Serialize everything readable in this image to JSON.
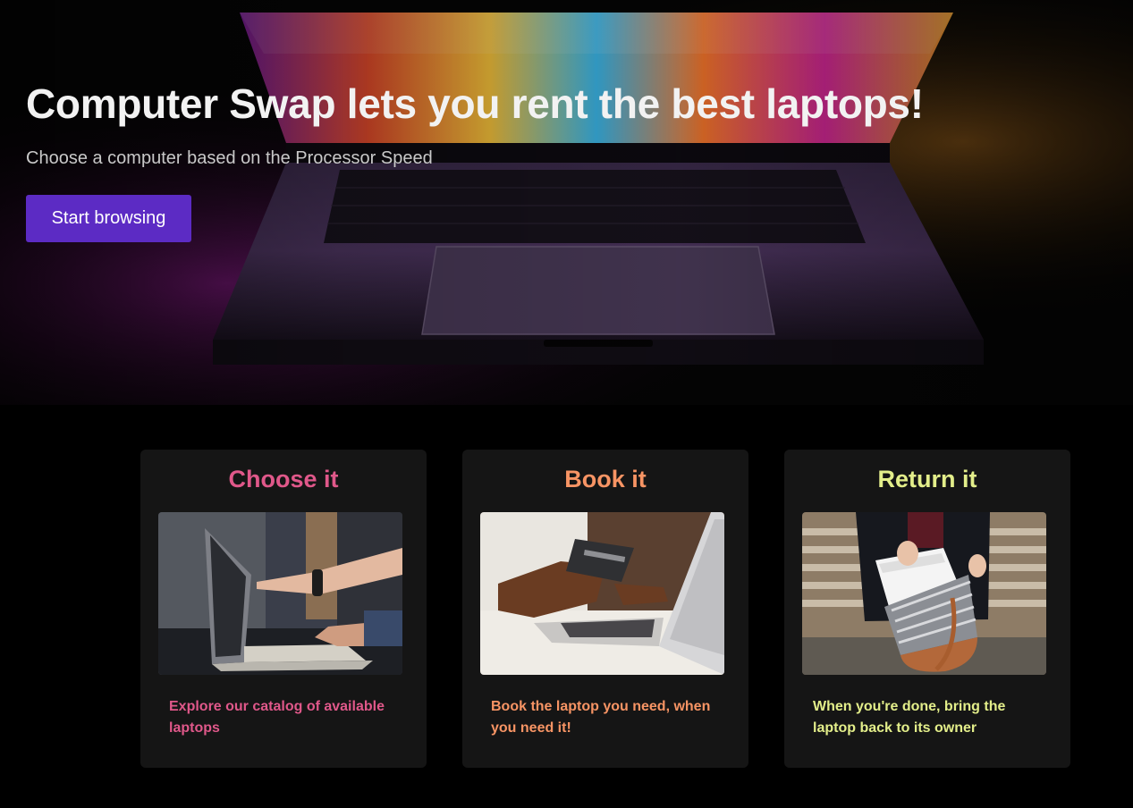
{
  "hero": {
    "title": "Computer Swap lets you rent the best laptops!",
    "subtitle": "Choose a computer based on the Processor Speed",
    "cta_label": "Start browsing"
  },
  "cards": [
    {
      "title": "Choose it",
      "text": "Explore our catalog of available laptops",
      "color": "#e0588a",
      "image": "laptop-pointing-photo"
    },
    {
      "title": "Book it",
      "text": "Book the laptop you need, when you need it!",
      "color": "#f79464",
      "image": "credit-card-payment-photo"
    },
    {
      "title": "Return it",
      "text": "When you're done, bring the laptop back to its owner",
      "color": "#e3ee8a",
      "image": "laptop-into-bag-photo"
    }
  ],
  "colors": {
    "background": "#000000",
    "card_background": "#151515",
    "cta_background": "#5c2bc4"
  }
}
